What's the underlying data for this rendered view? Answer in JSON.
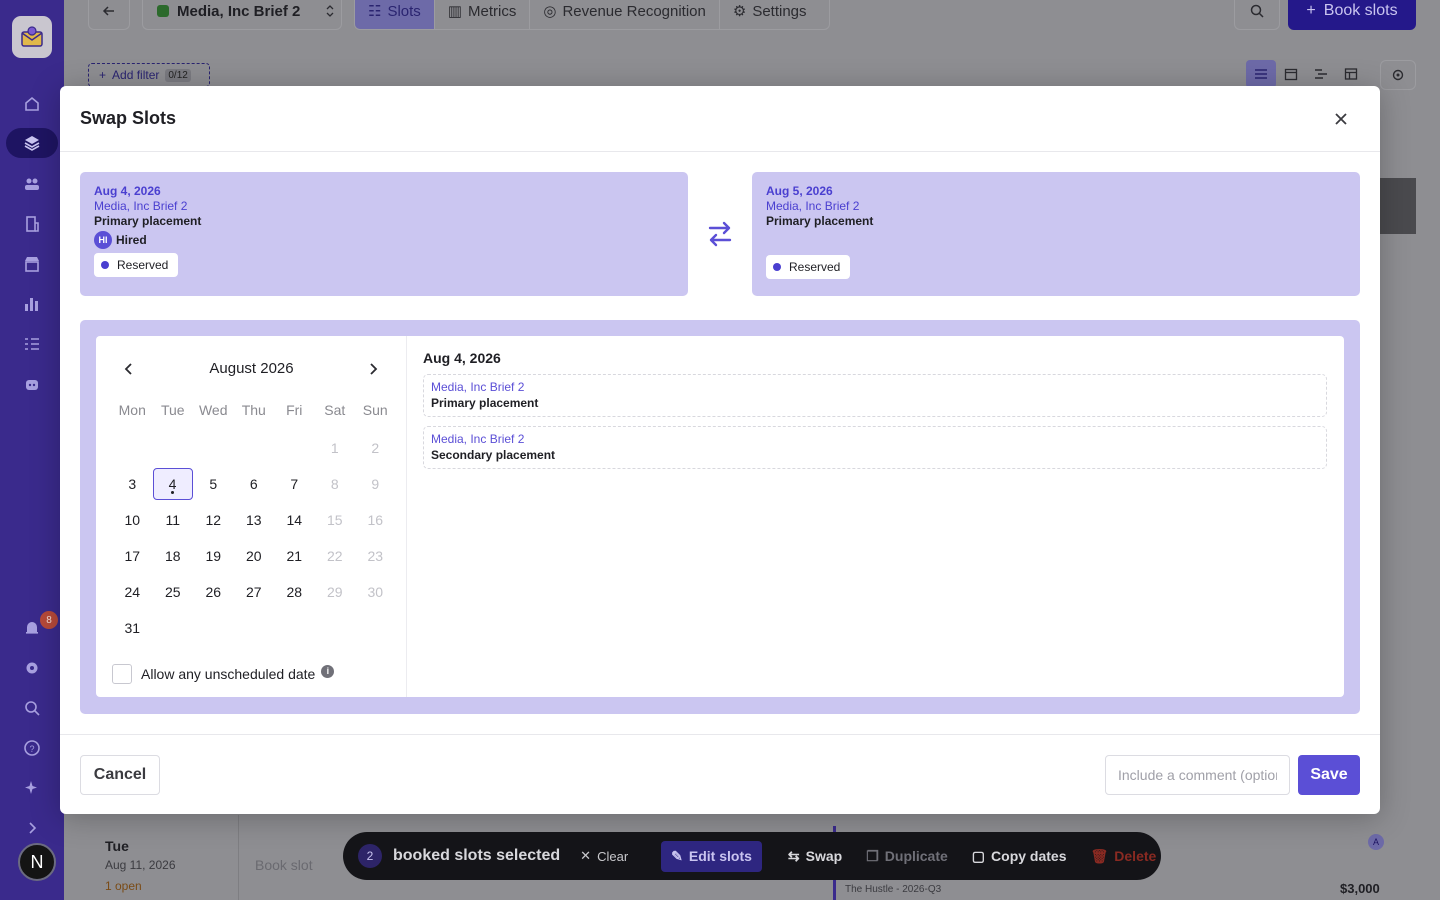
{
  "topbar": {
    "project_name": "Media, Inc Brief 2",
    "tabs": [
      {
        "label": "Slots",
        "icon": "list-icon"
      },
      {
        "label": "Metrics",
        "icon": "bar-chart-icon"
      },
      {
        "label": "Revenue Recognition",
        "icon": "dollar-circle-icon"
      },
      {
        "label": "Settings",
        "icon": "gear-icon"
      }
    ],
    "book_slots_label": "Book slots"
  },
  "filters": {
    "add_filter_label": "Add filter",
    "count": "0/12"
  },
  "sidebar": {
    "notification_count": "8",
    "user_initial": "N"
  },
  "modal": {
    "title": "Swap Slots",
    "source": {
      "date": "Aug 4, 2026",
      "brief": "Media, Inc Brief 2",
      "placement": "Primary placement",
      "hired_initials": "HI",
      "hired_label": "Hired",
      "status": "Reserved"
    },
    "target": {
      "date": "Aug 5, 2026",
      "brief": "Media, Inc Brief 2",
      "placement": "Primary placement",
      "status": "Reserved"
    },
    "calendar": {
      "month_label": "August 2026",
      "weekdays": [
        "Mon",
        "Tue",
        "Wed",
        "Thu",
        "Fri",
        "Sat",
        "Sun"
      ],
      "allow_unscheduled_label": "Allow any unscheduled date",
      "info_glyph": "i"
    },
    "selected_date_label": "Aug 4, 2026",
    "available_slots": [
      {
        "brief": "Media, Inc Brief 2",
        "placement": "Primary placement"
      },
      {
        "brief": "Media, Inc Brief 2",
        "placement": "Secondary placement"
      }
    ],
    "footer": {
      "cancel_label": "Cancel",
      "comment_placeholder": "Include a comment (optional)",
      "save_label": "Save"
    }
  },
  "background_row": {
    "day": "Tue",
    "date": "Aug 11, 2026",
    "open": "1 open",
    "book_slot": "Book slot",
    "sponsor": "The Hustle - 2026-Q3",
    "price": "$3,000",
    "avatar": "A"
  },
  "action_bar": {
    "selected_count": "2",
    "selected_text": "booked slots selected",
    "clear": "Clear",
    "edit_slots": "Edit slots",
    "swap": "Swap",
    "duplicate": "Duplicate",
    "copy_dates": "Copy dates",
    "delete": "Delete"
  },
  "colors": {
    "accent": "#5b4fd6",
    "sidebar": "#3a2a8c",
    "card": "#cbc6f1"
  }
}
